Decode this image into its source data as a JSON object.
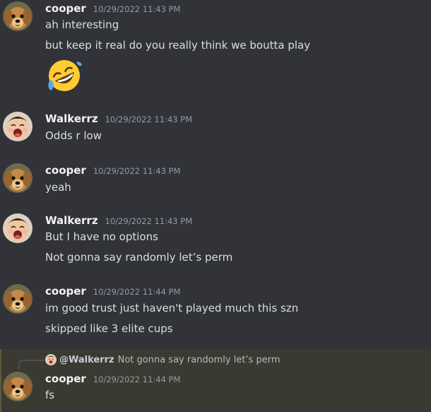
{
  "users": {
    "cooper": {
      "name": "cooper",
      "avatar_icon": "dog-avatar-icon"
    },
    "walkerrz": {
      "name": "Walkerrz",
      "avatar_icon": "laughing-child-avatar-icon"
    }
  },
  "messages": [
    {
      "author": "cooper",
      "timestamp": "10/29/2022 11:43 PM",
      "lines": [
        "ah interesting",
        "but keep it real do you really think we boutta play"
      ],
      "emoji": "rolling-on-floor-laughing-emoji-icon"
    },
    {
      "author": "Walkerrz",
      "timestamp": "10/29/2022 11:43 PM",
      "lines": [
        "Odds r low"
      ]
    },
    {
      "author": "cooper",
      "timestamp": "10/29/2022 11:43 PM",
      "lines": [
        "yeah"
      ]
    },
    {
      "author": "Walkerrz",
      "timestamp": "10/29/2022 11:43 PM",
      "lines": [
        "But I have no options",
        "Not gonna say randomly let’s perm"
      ]
    },
    {
      "author": "cooper",
      "timestamp": "10/29/2022 11:44 PM",
      "lines": [
        "im good trust just haven't played much this szn",
        "skipped like 3 elite cups"
      ]
    },
    {
      "author": "cooper",
      "timestamp": "10/29/2022 11:44 PM",
      "reply": {
        "mention": "@Walkerrz",
        "text": "Not gonna say randomly let’s perm"
      },
      "lines": [
        "fs"
      ]
    }
  ],
  "colors": {
    "background": "#313338",
    "highlight": "#3b3a32",
    "username": "#f2f3f5",
    "timestamp": "#949ba4",
    "text": "#dbdee1"
  }
}
